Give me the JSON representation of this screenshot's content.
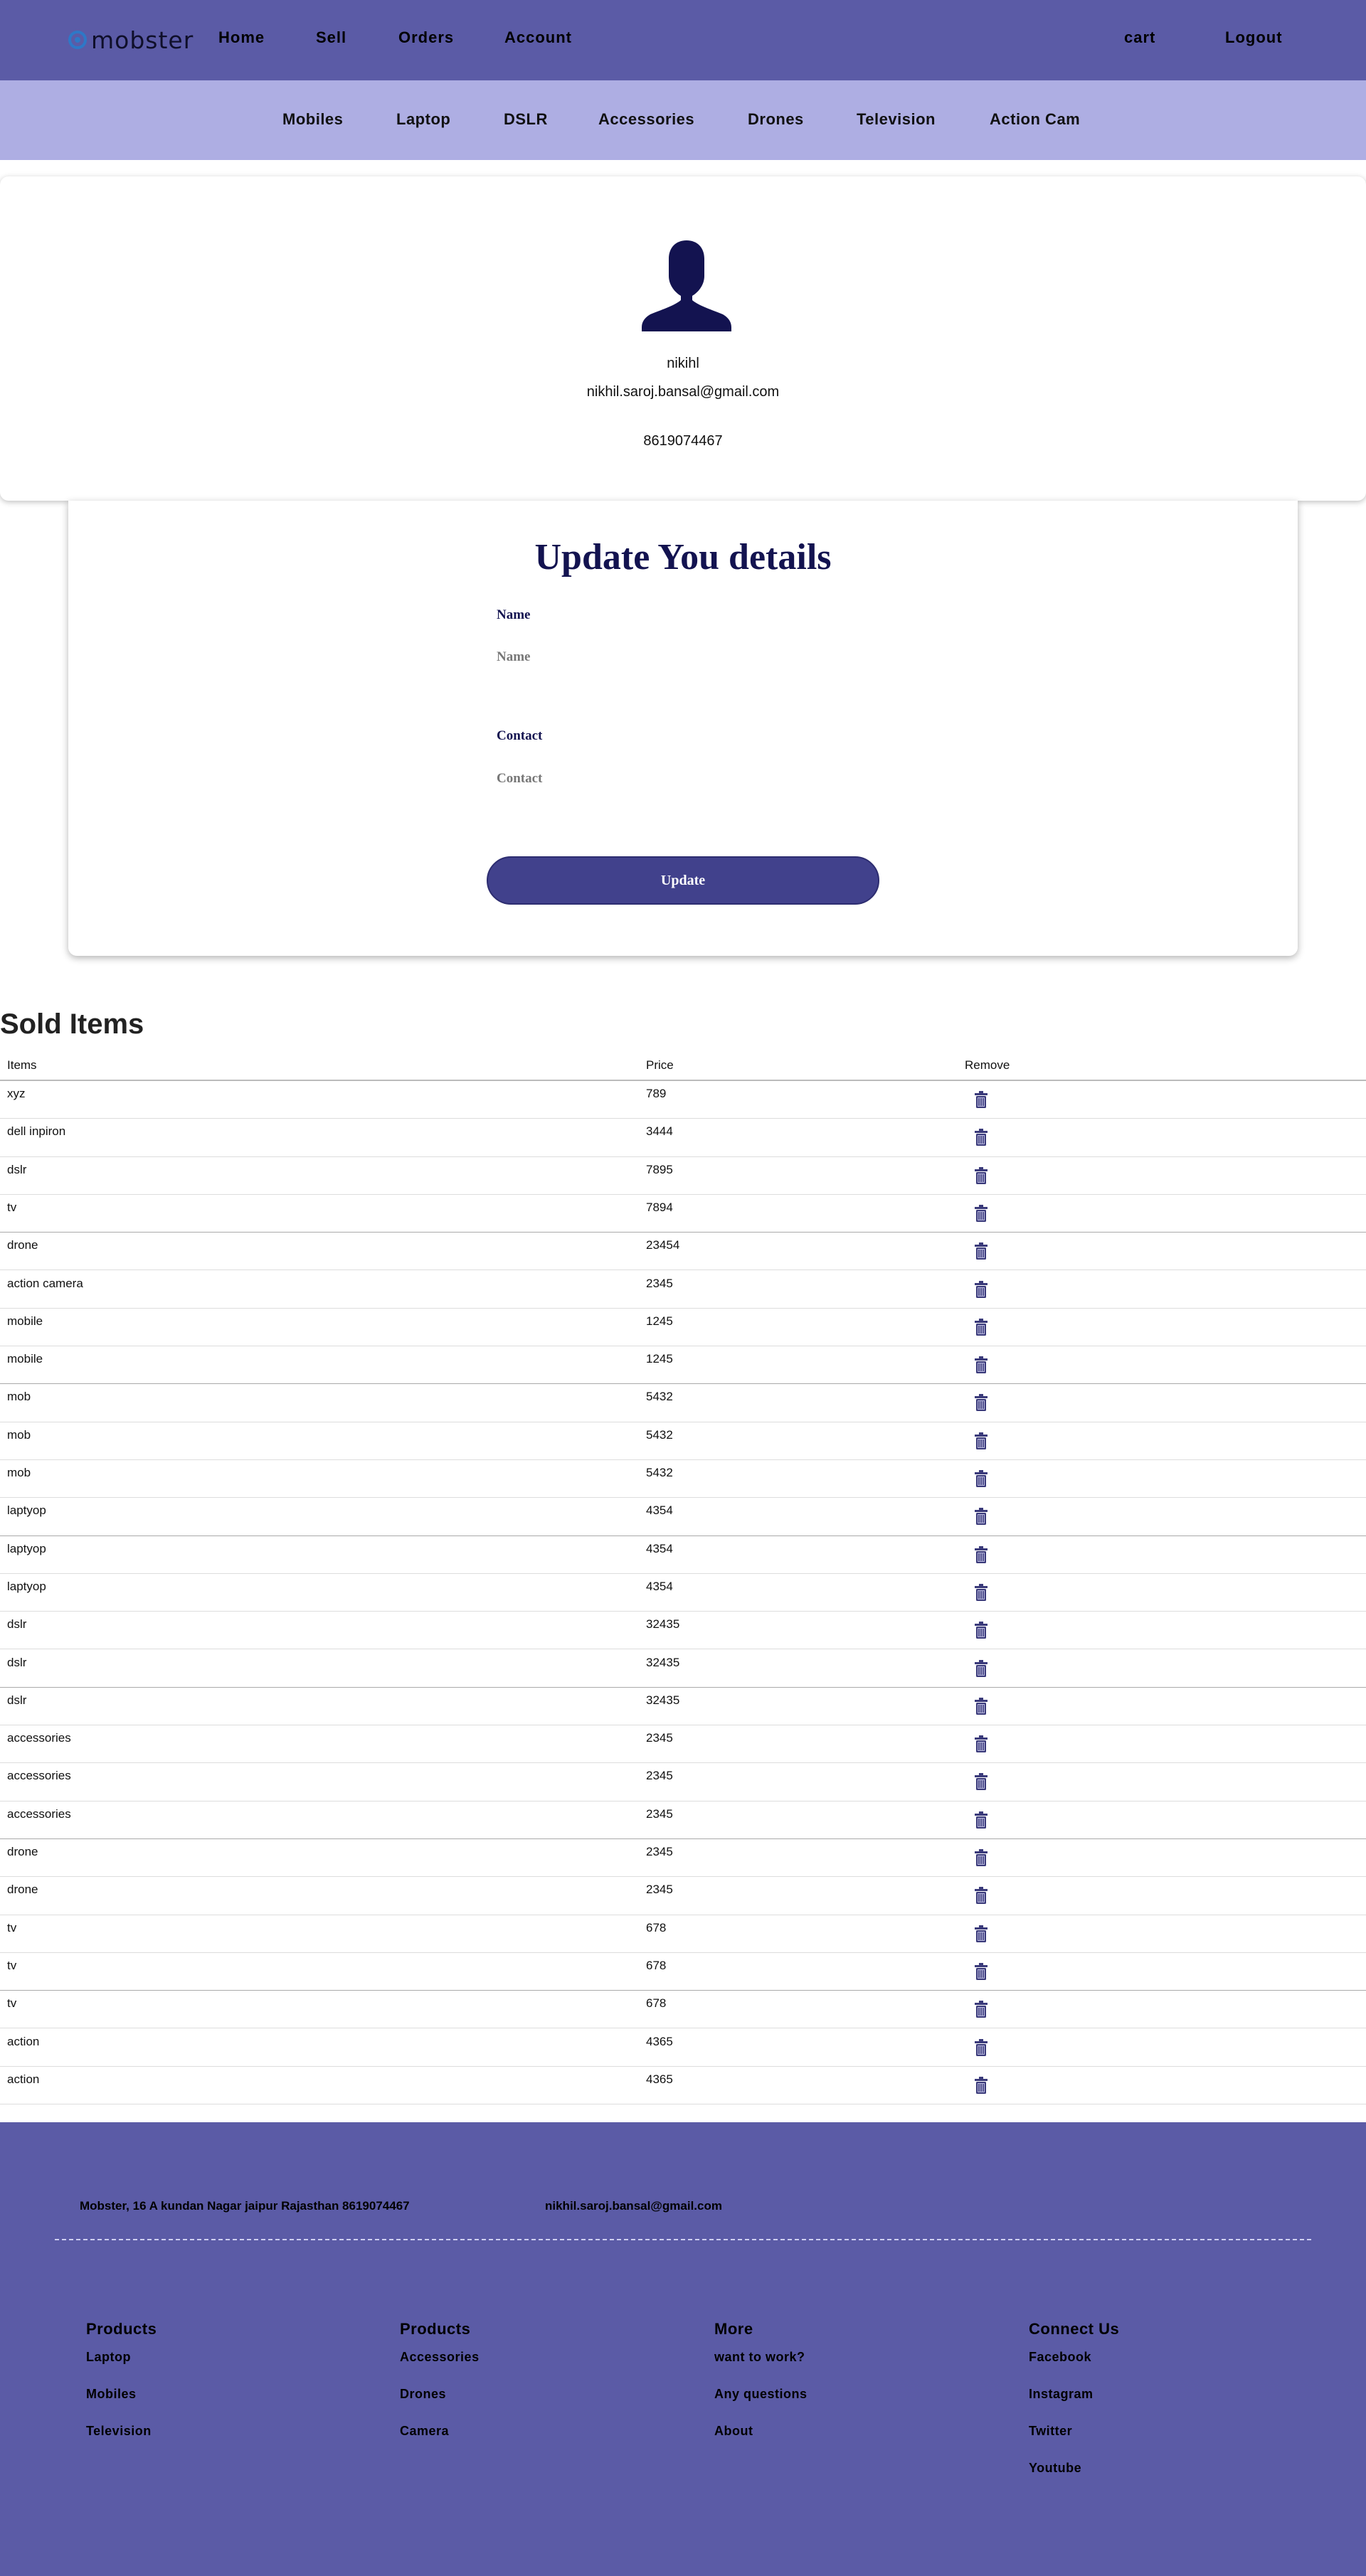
{
  "header": {
    "logo_text": "mobster",
    "nav_left": [
      "Home",
      "Sell",
      "Orders",
      "Account"
    ],
    "nav_right": [
      "cart",
      "Logout"
    ]
  },
  "categories": [
    "Mobiles",
    "Laptop",
    "DSLR",
    "Accessories",
    "Drones",
    "Television",
    "Action Cam"
  ],
  "profile": {
    "name": "nikihl",
    "email": "nikhil.saroj.bansal@gmail.com",
    "phone": "8619074467"
  },
  "update_form": {
    "title": "Update You details",
    "name_label": "Name",
    "name_placeholder": "Name",
    "contact_label": "Contact",
    "contact_placeholder": "Contact",
    "submit_label": "Update"
  },
  "sold_items": {
    "title": "Sold Items",
    "columns": [
      "Items",
      "Price",
      "Remove"
    ],
    "rows": [
      {
        "item": "xyz",
        "price": "789"
      },
      {
        "item": "dell inpiron",
        "price": "3444"
      },
      {
        "item": "dslr",
        "price": "7895"
      },
      {
        "item": "tv",
        "price": "7894"
      },
      {
        "item": "drone",
        "price": "23454"
      },
      {
        "item": "action camera",
        "price": "2345"
      },
      {
        "item": "mobile",
        "price": "1245"
      },
      {
        "item": "mobile",
        "price": "1245"
      },
      {
        "item": "mob",
        "price": "5432"
      },
      {
        "item": "mob",
        "price": "5432"
      },
      {
        "item": "mob",
        "price": "5432"
      },
      {
        "item": "laptyop",
        "price": "4354"
      },
      {
        "item": "laptyop",
        "price": "4354"
      },
      {
        "item": "laptyop",
        "price": "4354"
      },
      {
        "item": "dslr",
        "price": "32435"
      },
      {
        "item": "dslr",
        "price": "32435"
      },
      {
        "item": "dslr",
        "price": "32435"
      },
      {
        "item": "accessories",
        "price": "2345"
      },
      {
        "item": "accessories",
        "price": "2345"
      },
      {
        "item": "accessories",
        "price": "2345"
      },
      {
        "item": "drone",
        "price": "2345"
      },
      {
        "item": "drone",
        "price": "2345"
      },
      {
        "item": "tv",
        "price": "678"
      },
      {
        "item": "tv",
        "price": "678"
      },
      {
        "item": "tv",
        "price": "678"
      },
      {
        "item": "action",
        "price": "4365"
      },
      {
        "item": "action",
        "price": "4365"
      }
    ]
  },
  "footer": {
    "address": "Mobster, 16 A kundan Nagar jaipur Rajasthan  8619074467",
    "email": "nikhil.saroj.bansal@gmail.com",
    "columns": [
      {
        "heading": "Products",
        "links": [
          "Laptop",
          "Mobiles",
          "Television"
        ]
      },
      {
        "heading": "Products",
        "links": [
          "Accessories",
          "Drones",
          "Camera"
        ]
      },
      {
        "heading": "More",
        "links": [
          "want to work?",
          "Any questions",
          "About"
        ]
      },
      {
        "heading": "Connect Us",
        "links": [
          "Facebook",
          "Instagram",
          "Twitter",
          "Youtube"
        ]
      }
    ]
  },
  "icons": {
    "logo": "logo-mark-icon",
    "avatar": "user-silhouette-icon",
    "remove": "trash-icon"
  },
  "colors": {
    "nav_bg": "#5b5ba6",
    "category_bg": "#aeaee3",
    "accent_dark": "#131350",
    "button_bg": "#41418c",
    "footer_bg": "#5b5ba6"
  }
}
